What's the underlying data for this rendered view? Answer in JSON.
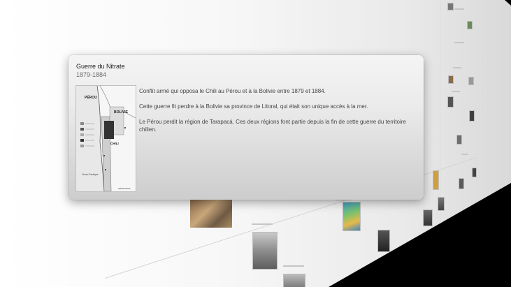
{
  "popover": {
    "title": "Guerre du Nitrate",
    "dates": "1879-1884",
    "image": {
      "icon": "historical-map",
      "labels": {
        "peru": "PÉROU",
        "bolivia": "BOLIVIE",
        "chile": "CHILI",
        "ocean": "Océan Pacifique",
        "argentina": "ARGENTINE"
      }
    },
    "paragraphs": [
      "Conflit armé qui opposa le Chili au Pérou et à la Bolivie entre 1879 et 1884.",
      "Cette guerre fit perdre à la Bolivie sa province de Litoral, qui était son unique accès à la mer.",
      "Le Pérou perdit la région de Tarapacá. Ces deux régions font partie depuis la fin de cette guerre du territoire chilien."
    ]
  }
}
